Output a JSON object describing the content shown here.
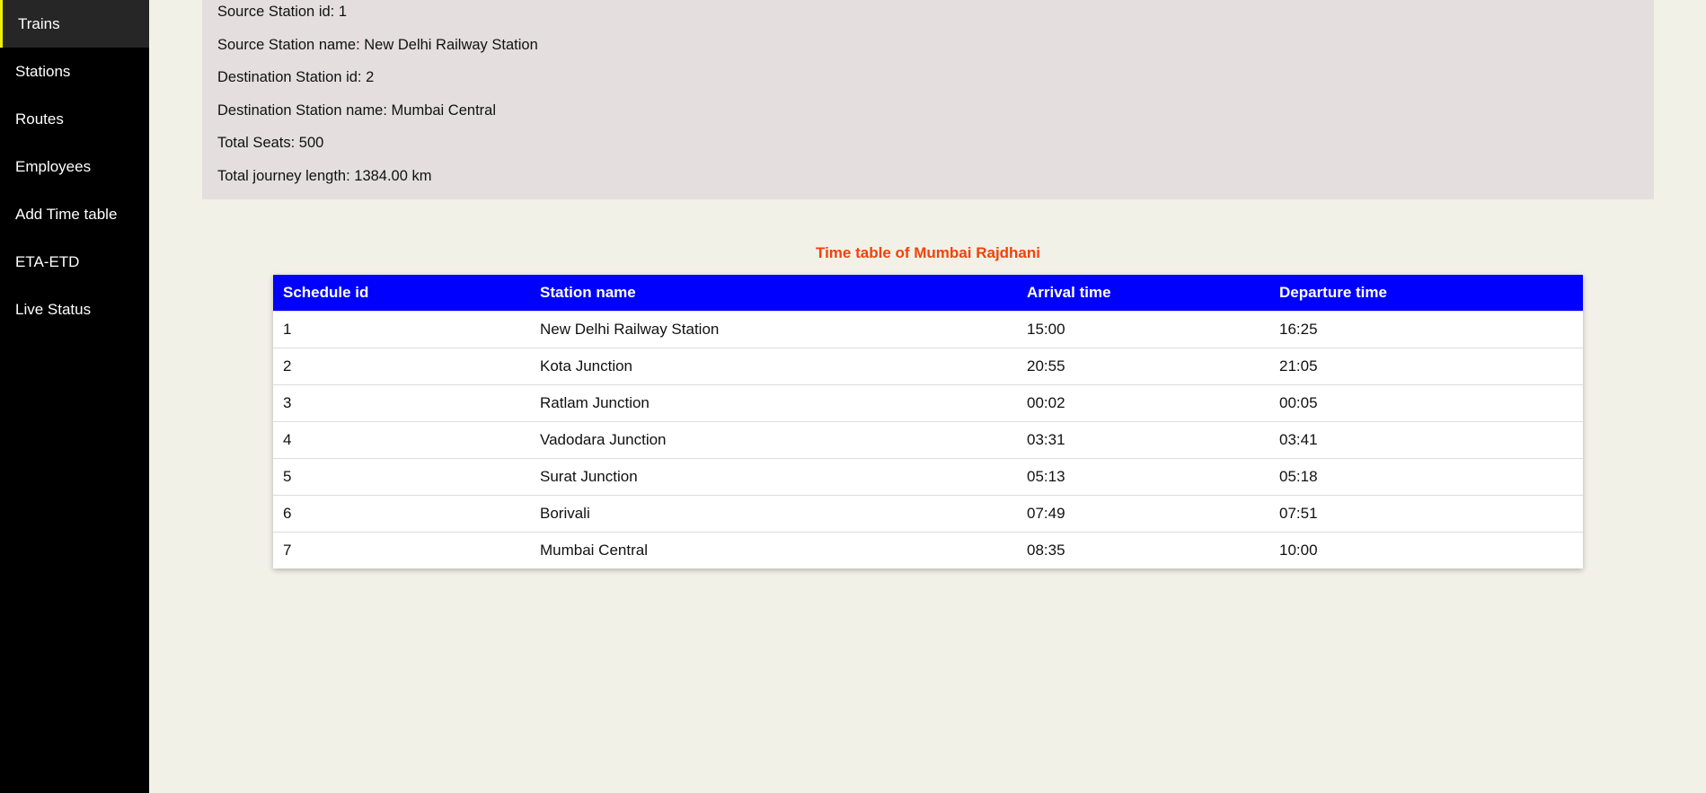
{
  "sidebar": {
    "items": [
      {
        "label": "Trains",
        "active": true
      },
      {
        "label": "Stations"
      },
      {
        "label": "Routes"
      },
      {
        "label": "Employees"
      },
      {
        "label": "Add Time table"
      },
      {
        "label": "ETA-ETD"
      },
      {
        "label": "Live Status"
      }
    ]
  },
  "info": {
    "lines": [
      "Source Station id: 1",
      "Source Station name: New Delhi Railway Station",
      "Destination Station id: 2",
      "Destination Station name: Mumbai Central",
      "Total Seats: 500",
      "Total journey length: 1384.00 km"
    ]
  },
  "timetable": {
    "title": "Time table of Mumbai Rajdhani",
    "headers": [
      "Schedule id",
      "Station name",
      "Arrival time",
      "Departure time"
    ],
    "rows": [
      [
        "1",
        "New Delhi Railway Station",
        "15:00",
        "16:25"
      ],
      [
        "2",
        "Kota Junction",
        "20:55",
        "21:05"
      ],
      [
        "3",
        "Ratlam Junction",
        "00:02",
        "00:05"
      ],
      [
        "4",
        "Vadodara Junction",
        "03:31",
        "03:41"
      ],
      [
        "5",
        "Surat Junction",
        "05:13",
        "05:18"
      ],
      [
        "6",
        "Borivali",
        "07:49",
        "07:51"
      ],
      [
        "7",
        "Mumbai Central",
        "08:35",
        "10:00"
      ]
    ]
  },
  "colors": {
    "sidebar_bg": "#000000",
    "active_accent": "#f0f000",
    "panel_bg": "#e4dedf",
    "page_bg": "#f2f1e8",
    "title_color": "#f2420a",
    "header_bg": "#0000ff"
  }
}
